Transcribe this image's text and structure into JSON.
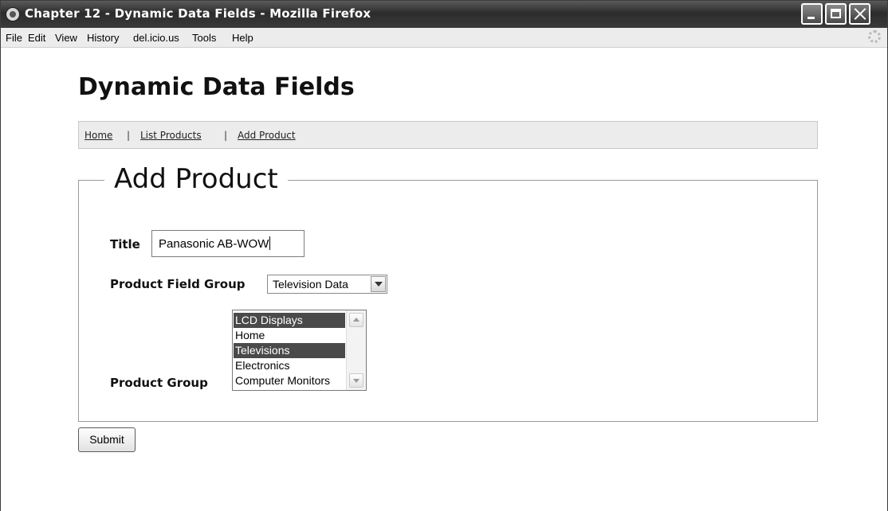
{
  "window": {
    "title": "Chapter 12 - Dynamic Data Fields - Mozilla Firefox"
  },
  "menu": {
    "items": [
      "File",
      "Edit",
      "View",
      "History",
      "del.icio.us",
      "Tools",
      "Help"
    ]
  },
  "page": {
    "title": "Dynamic Data Fields",
    "nav": {
      "home": "Home",
      "list_products": "List Products",
      "add_product": "Add Product",
      "separator": "|"
    },
    "form": {
      "legend": "Add Product",
      "title_label": "Title",
      "title_value": "Panasonic AB-WOW",
      "field_group_label": "Product Field Group",
      "field_group_value": "Television Data",
      "product_group_label": "Product Group",
      "product_group_options": [
        {
          "label": "LCD Displays",
          "selected": true
        },
        {
          "label": "Home",
          "selected": false
        },
        {
          "label": "Televisions",
          "selected": true
        },
        {
          "label": "Electronics",
          "selected": false
        },
        {
          "label": "Computer Monitors",
          "selected": false
        }
      ],
      "submit_label": "Submit"
    }
  },
  "icons": [
    "firefox-icon",
    "minimize-icon",
    "maximize-icon",
    "close-icon",
    "throbber-icon",
    "scroll-up-icon",
    "scroll-down-icon",
    "dropdown-arrow-icon"
  ]
}
